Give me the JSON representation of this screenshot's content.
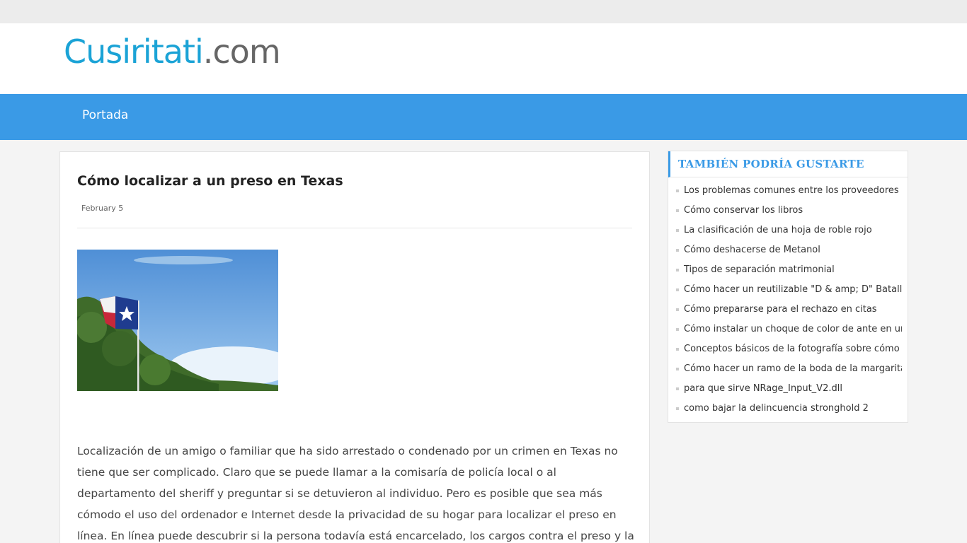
{
  "site": {
    "brand": "Cusiritati",
    "tld": ".com"
  },
  "nav": {
    "items": [
      "Portada"
    ]
  },
  "post": {
    "title": "Cómo localizar a un preso en Texas",
    "date": "February 5",
    "image_icon": "texas-flag-photo",
    "body": "Localización de un amigo o familiar que ha sido arrestado o condenado por un crimen en Texas no tiene que ser complicado. Claro que se puede llamar a la comisaría de policía local o al departamento del sheriff y preguntar si se detuvieron al individuo. Pero es posible que sea más cómodo el uso del ordenador e Internet desde la privacidad de su hogar para localizar el preso en línea. En línea puede descubrir si la persona todavía está encarcelado, los cargos contra el preso y la dirección del centro penitenciario donde se celebra el"
  },
  "sidebar": {
    "title": "TAMBIÉN PODRÍA GUSTARTE",
    "items": [
      "Los problemas comunes entre los proveedores d",
      "Cómo conservar los libros",
      "La clasificación de una hoja de roble rojo",
      "Cómo deshacerse de Metanol",
      "Tipos de separación matrimonial",
      "Cómo hacer un reutilizable \"D & amp; D\" Batalla",
      "Cómo prepararse para el rechazo en citas",
      "Cómo instalar un choque de color de ante en una",
      "Conceptos básicos de la fotografía sobre cómo o",
      "Cómo hacer un ramo de la boda de la margarita",
      "para que sirve NRage_Input_V2.dll",
      "como bajar la delincuencia stronghold 2"
    ]
  },
  "colors": {
    "accent": "#3a9ae6",
    "brand": "#1ba3d6",
    "tld": "#666666",
    "background": "#f4f4f4"
  }
}
